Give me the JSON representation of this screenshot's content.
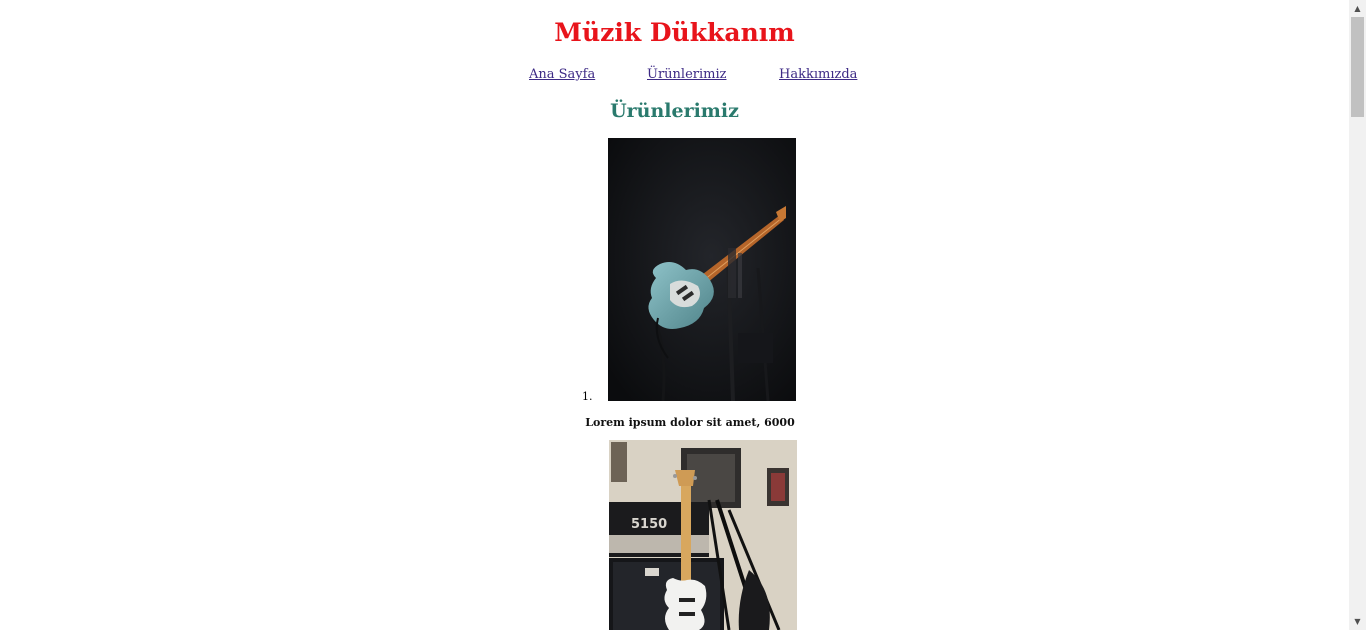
{
  "site": {
    "title": "Müzik Dükkanım",
    "title_color": "#e8141b"
  },
  "nav": {
    "link_color": "#3d2a85",
    "items": [
      {
        "label": "Ana Sayfa"
      },
      {
        "label": "Ürünlerimiz"
      },
      {
        "label": "Hakkımızda"
      }
    ]
  },
  "products_section": {
    "title": "Ürünlerimiz",
    "title_color": "#2a7a6d",
    "items": [
      {
        "marker": "1.",
        "caption": "Lorem ipsum dolor sit amet, 6000",
        "image_icon": "electric-guitar-dark-stage-image"
      },
      {
        "image_icon": "white-guitar-amp-room-image"
      }
    ]
  },
  "scrollbar": {
    "up_icon": "▲",
    "down_icon": "▼"
  }
}
